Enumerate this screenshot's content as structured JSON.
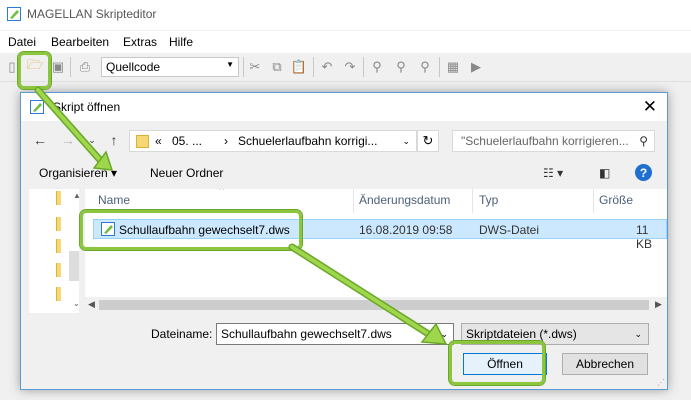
{
  "app": {
    "title": "MAGELLAN Skripteditor",
    "menu": [
      "Datei",
      "Bearbeiten",
      "Extras",
      "Hilfe"
    ],
    "toolbar": {
      "combo_value": "Quellcode"
    }
  },
  "dialog": {
    "title": "Skript öffnen",
    "address": {
      "prefix": "«",
      "crumb1": "05. ...",
      "sep": "›",
      "crumb2": "Schuelerlaufbahn korrigi..."
    },
    "search_placeholder": "\"Schuelerlaufbahn korrigieren...",
    "commands": {
      "organize": "Organisieren ▾",
      "new_folder": "Neuer Ordner"
    },
    "columns": [
      "Name",
      "Änderungsdatum",
      "Typ",
      "Größe"
    ],
    "files": [
      {
        "name": "Schullaufbahn gewechselt7.dws",
        "date": "16.08.2019 09:58",
        "type": "DWS-Datei",
        "size": "11 KB"
      }
    ],
    "filename_label": "Dateiname:",
    "filename_value": "Schullaufbahn gewechselt7.dws",
    "filter_value": "Skriptdateien (*.dws)",
    "open_label": "Öffnen",
    "cancel_label": "Abbrechen"
  },
  "colors": {
    "highlight": "#8cc63f",
    "selection": "#cce8ff",
    "accent": "#0078d7"
  }
}
